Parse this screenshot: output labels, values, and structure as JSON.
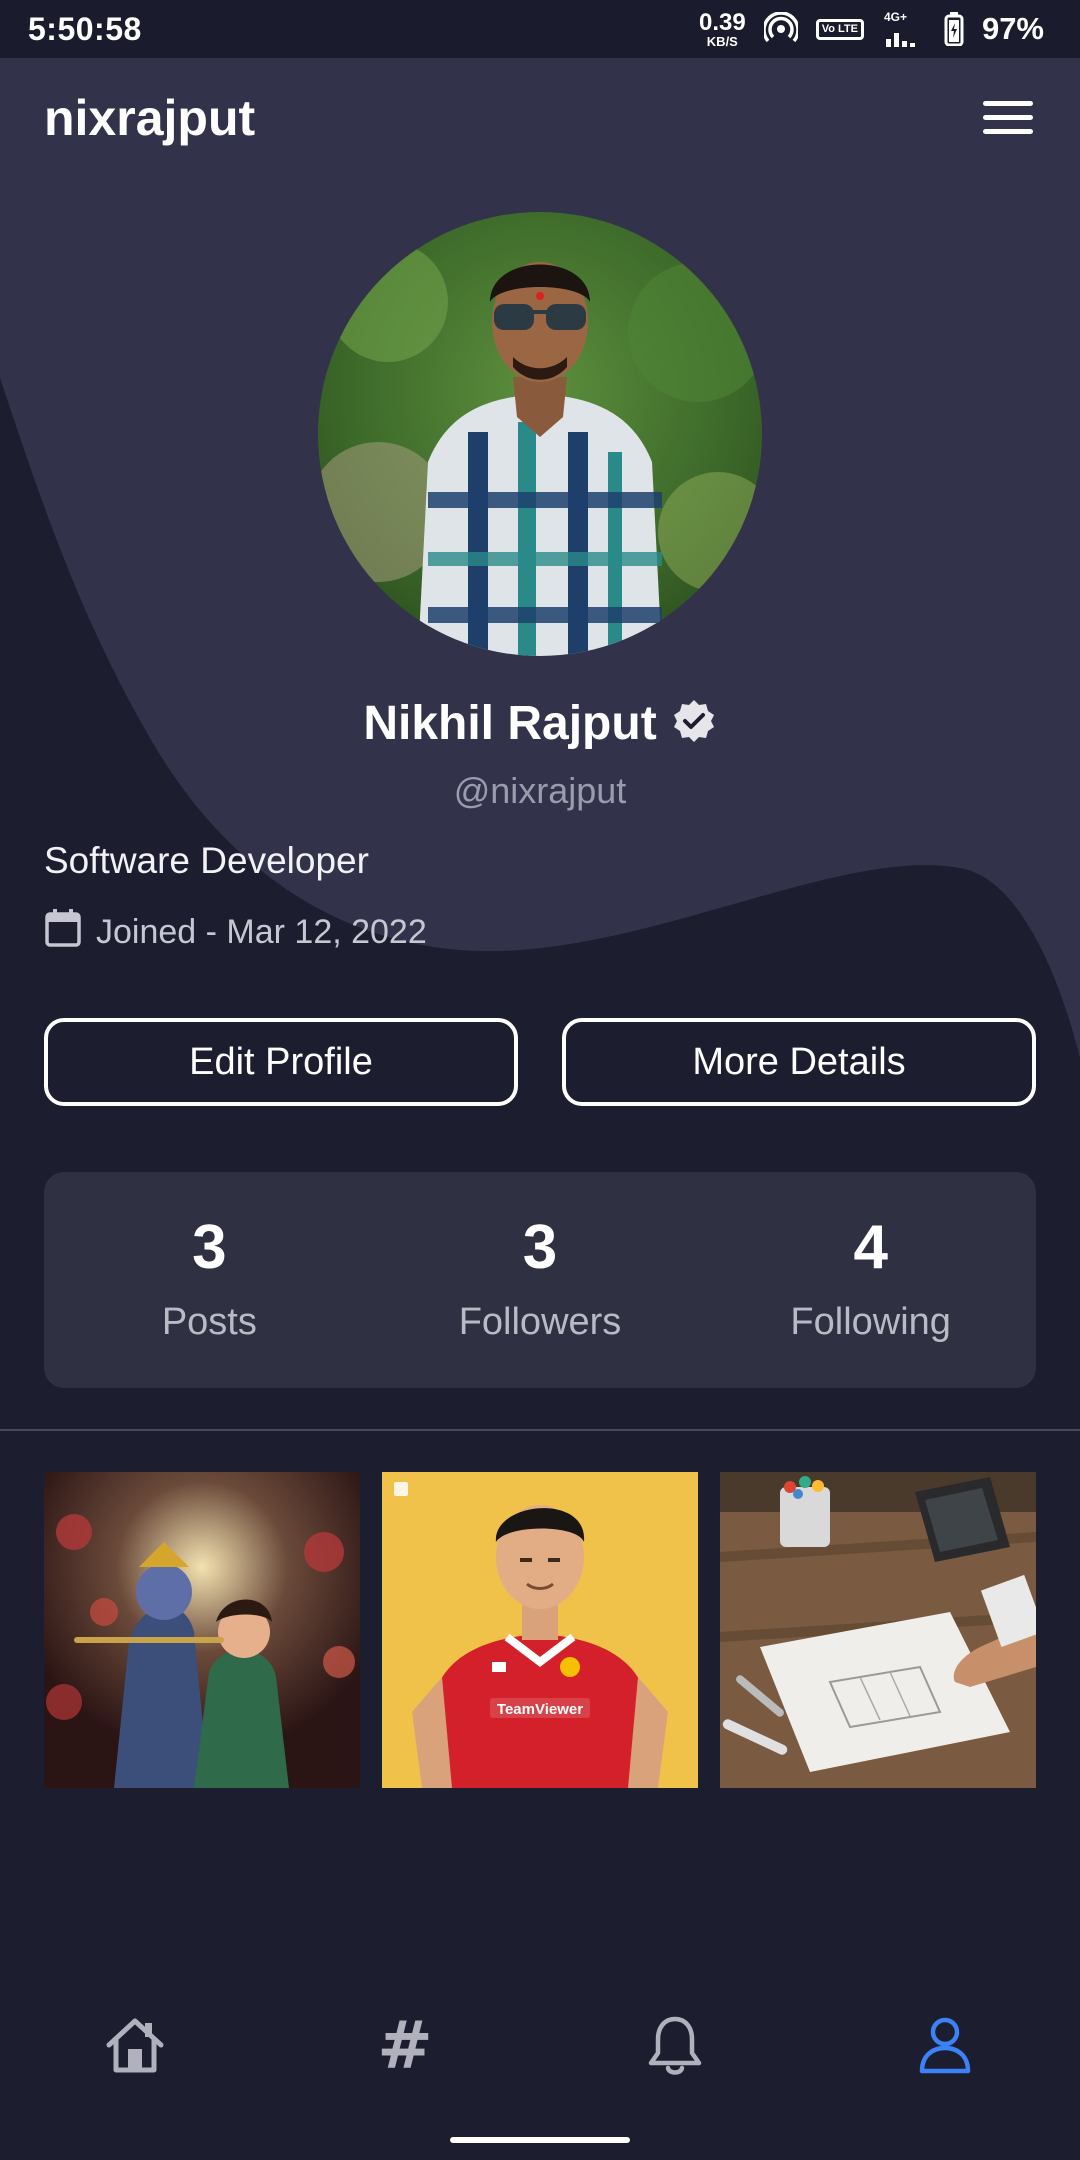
{
  "status_bar": {
    "time": "5:50:58",
    "net_speed_value": "0.39",
    "net_speed_unit": "KB/S",
    "volte_label": "Vo LTE",
    "network_type": "4G+",
    "battery": "97%"
  },
  "header": {
    "title": "nixrajput",
    "menu_icon": "hamburger-menu-icon"
  },
  "profile": {
    "name": "Nikhil Rajput",
    "verified_icon": "verified-badge-icon",
    "handle": "@nixrajput",
    "bio": "Software Developer",
    "joined_icon": "calendar-icon",
    "joined": "Joined - Mar 12, 2022"
  },
  "actions": {
    "edit_profile": "Edit Profile",
    "more_details": "More Details"
  },
  "stats": [
    {
      "value": "3",
      "label": "Posts"
    },
    {
      "value": "3",
      "label": "Followers"
    },
    {
      "value": "4",
      "label": "Following"
    }
  ],
  "posts": [
    {
      "subject": "krishna-radha-artwork"
    },
    {
      "subject": "footballer-cartoon-red-jersey",
      "jersey_text": "TeamViewer"
    },
    {
      "subject": "architect-desk-drawing"
    }
  ],
  "bottom_nav": [
    {
      "icon": "home-icon",
      "active": false
    },
    {
      "icon": "hashtag-icon",
      "label": "#",
      "active": false
    },
    {
      "icon": "bell-icon",
      "active": false
    },
    {
      "icon": "profile-icon",
      "active": true
    }
  ],
  "colors": {
    "background": "#1c1d2e",
    "wave": "#32334a",
    "card": "#2f3042",
    "active_nav": "#3b82f6",
    "inactive_nav": "#b0b1bd"
  }
}
